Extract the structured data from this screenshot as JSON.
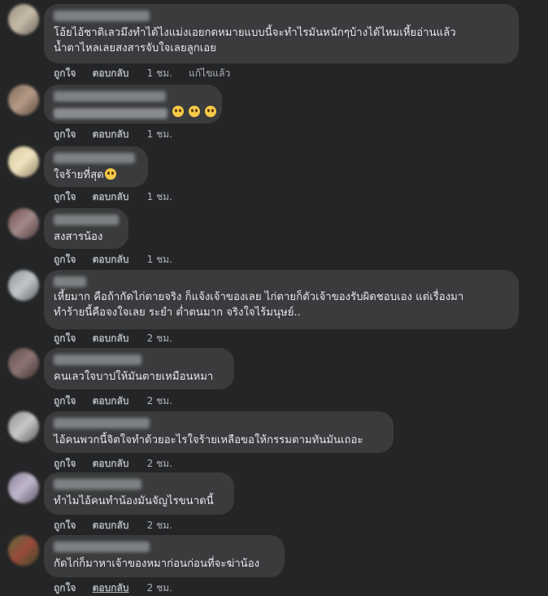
{
  "colors": {
    "background": "#242526",
    "bubble": "#3a3b3c",
    "text": "#e4e6eb",
    "secondary_text": "#b0b3b8"
  },
  "comments": [
    {
      "text": "โอ้ยไอ้ชาติเลวมึงทำได้ไงแม่งเอยกดหมายแบบนี้จะทำไรมันหนักๆบ้างได้ไหมเหี้ยอ่านแล้ว\nน้ำตาไหลเลยสงสารจับใจเลยลูกเอย",
      "like": "ถูกใจ",
      "reply": "ตอบกลับ",
      "time": "1 ชม.",
      "edited": "แก้ไขแล้ว"
    },
    {
      "text": "",
      "like": "ถูกใจ",
      "reply": "ตอบกลับ",
      "time": "1 ชม."
    },
    {
      "text": "ใจร้ายที่สุด",
      "like": "ถูกใจ",
      "reply": "ตอบกลับ",
      "time": "1 ชม."
    },
    {
      "text": "สงสารน้อง",
      "like": "ถูกใจ",
      "reply": "ตอบกลับ",
      "time": "1 ชม."
    },
    {
      "text": "เหี้ยมาก คือถ้ากัดไก่ตายจริง ก็แจ้งเจ้าของเลย ไก่ตายก็ตัวเจ้าของรับผิดชอบเอง แต่เรื่องมา\nทำร้ายนี้คือจงใจเลย ระยำ ต่ำตนมาก จริงใจไร้มนุษย์..",
      "like": "ถูกใจ",
      "reply": "ตอบกลับ",
      "time": "2 ชม."
    },
    {
      "text": "คนเลวใจบาปให้มันตายเหมือนหมา",
      "like": "ถูกใจ",
      "reply": "ตอบกลับ",
      "time": "2 ชม."
    },
    {
      "text": "ไอ้คนพวกนี้จิตใจทำด้วยอะไรใจร้ายเหลือขอให้กรรมตามทันมันเถอะ",
      "like": "ถูกใจ",
      "reply": "ตอบกลับ",
      "time": "2 ชม."
    },
    {
      "text": "ทำไมไอ้คนทำน้องมันจัญไรขนาดนี้",
      "like": "ถูกใจ",
      "reply": "ตอบกลับ",
      "time": "2 ชม."
    },
    {
      "text": "กัดไก่ก็มาหาเจ้าของหมาก่อนก่อนที่จะฆ่าน้อง",
      "like": "ถูกใจ",
      "reply": "ตอบกลับ",
      "time": "2 ชม."
    }
  ]
}
